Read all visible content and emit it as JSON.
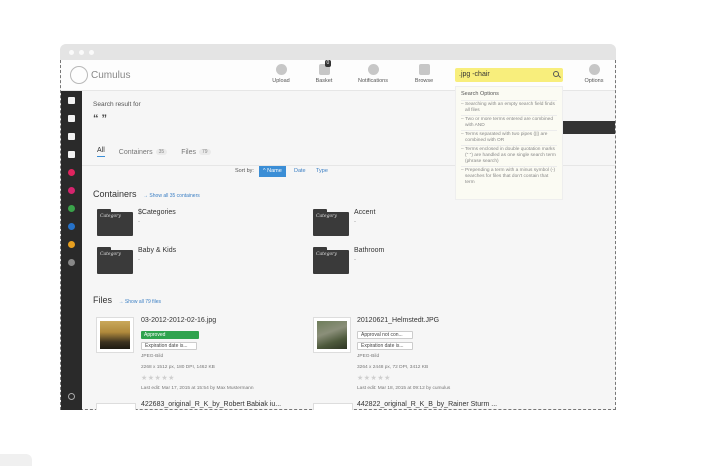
{
  "app": {
    "name": "Cumulus"
  },
  "nav": [
    {
      "label": "Upload",
      "icon": "upload-icon"
    },
    {
      "label": "Basket",
      "icon": "basket-icon",
      "badge": "0"
    },
    {
      "label": "Notifications",
      "icon": "info-icon"
    },
    {
      "label": "Browse",
      "icon": "folder-icon"
    },
    {
      "label": "Options",
      "icon": "user-icon"
    }
  ],
  "search": {
    "value": ".jpg -chair",
    "options_title": "Search Options",
    "options": [
      "Searching with an empty search field finds all files",
      "Two or more terms entered are combined with AND",
      "Terms separated with two pipes (||) are combined with OR",
      "Terms enclosed in double quotation marks (\" \") are handled as one single search term (phrase search)",
      "Prepending a term with a minus symbol (-) searches for files that don't contain that term"
    ]
  },
  "sidebar": {
    "icons": [
      {
        "name": "docs-icon"
      },
      {
        "name": "users-icon"
      },
      {
        "name": "share-icon"
      },
      {
        "name": "book-icon"
      },
      {
        "name": "pink-dot-icon",
        "color": "#e0245e"
      },
      {
        "name": "magenta-dot-icon",
        "color": "#d6246e"
      },
      {
        "name": "green-dot-icon",
        "color": "#3aa34a"
      },
      {
        "name": "blue-dot-icon",
        "color": "#2672c9"
      },
      {
        "name": "orange-dot-icon",
        "color": "#e8a020"
      },
      {
        "name": "grey-dot-icon",
        "color": "#888888"
      },
      {
        "name": "help-icon"
      }
    ]
  },
  "results": {
    "heading": "Search result for",
    "query": "“ ”",
    "tabs": [
      {
        "label": "All",
        "count": ""
      },
      {
        "label": "Containers",
        "count": "35"
      },
      {
        "label": "Files",
        "count": "79"
      }
    ],
    "sort": {
      "label": "Sort by:",
      "options": [
        "^ Name",
        "Date",
        "Type"
      ]
    }
  },
  "containers": {
    "title": "Containers",
    "link": "→ Show all 35 containers",
    "folder_label": "Category",
    "items": [
      {
        "name": "$Categories",
        "sub": "-"
      },
      {
        "name": "Accent",
        "sub": "-"
      },
      {
        "name": "Baby & Kids",
        "sub": "-"
      },
      {
        "name": "Bathroom",
        "sub": "-"
      }
    ]
  },
  "files": {
    "title": "Files",
    "link": "→ Show all 79 files",
    "items": [
      {
        "name": "03-2012-2012-02-16.jpg",
        "status": "Approved",
        "expiration": "Expiration date is...",
        "type": "JPEG-Bild",
        "details": "2268 x 1512 px, 180 DPI, 1462 KB",
        "stars": "★★★★★",
        "edited": "Last edit: Mar 17, 2015 at 15:54 by Max Mustermann"
      },
      {
        "name": "20120621_Helmstedt.JPG",
        "status": "Approval not con...",
        "expiration": "Expiration date is...",
        "type": "JPEG-Bild",
        "details": "3264 x 2448 px, 72 DPI, 3412 KB",
        "stars": "★★★★★",
        "edited": "Last edit: Mar 18, 2015 at 09:12 by cumulus"
      }
    ],
    "more": [
      "422683_original_R_K_by_Robert Babiak iu...",
      "442822_original_R_K_B_by_Rainer Sturm ..."
    ]
  }
}
